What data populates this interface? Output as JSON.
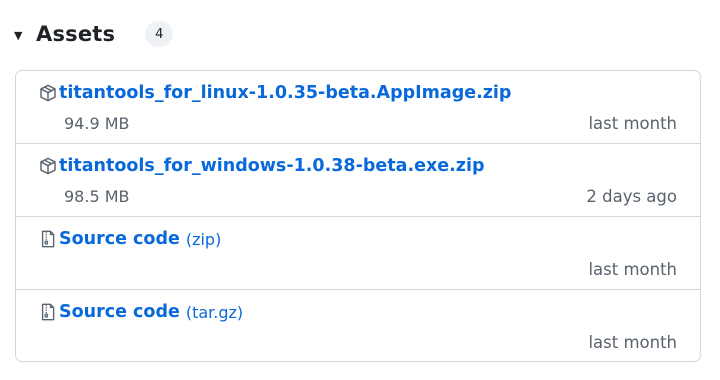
{
  "assets": {
    "title": "Assets",
    "count": "4",
    "items": [
      {
        "name": "titantools_for_linux-1.0.35-beta.AppImage.zip",
        "suffix": "",
        "size": "94.9 MB",
        "date": "last month",
        "icon": "package-icon"
      },
      {
        "name": "titantools_for_windows-1.0.38-beta.exe.zip",
        "suffix": "",
        "size": "98.5 MB",
        "date": "2 days ago",
        "icon": "package-icon"
      },
      {
        "name": "Source code",
        "suffix": "(zip)",
        "size": "",
        "date": "last month",
        "icon": "file-zip-icon"
      },
      {
        "name": "Source code",
        "suffix": "(tar.gz)",
        "size": "",
        "date": "last month",
        "icon": "file-zip-icon"
      }
    ]
  },
  "colors": {
    "link": "#0969da",
    "muted": "#59636e",
    "border": "#d1d9e0",
    "badge_bg": "#eff2f5"
  }
}
